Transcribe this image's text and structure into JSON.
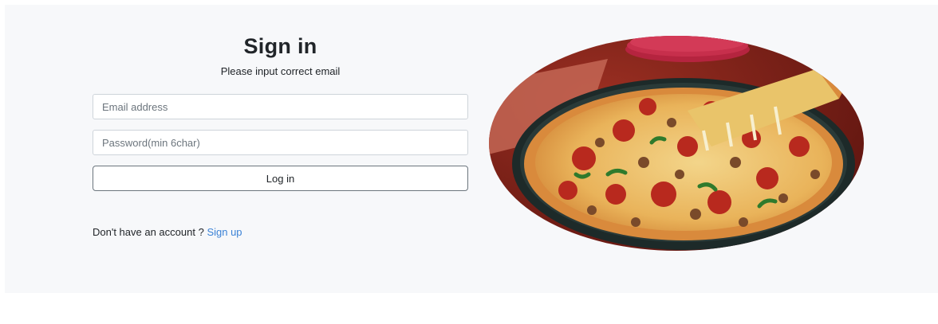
{
  "signin": {
    "title": "Sign in",
    "subtitle": "Please input correct email",
    "email_placeholder": "Email address",
    "password_placeholder": "Password(min 6char)",
    "login_label": "Log in",
    "no_account_text": "Don't have an account ?",
    "signup_link": "Sign up"
  },
  "colors": {
    "link": "#3b82d6",
    "panel_bg": "#f7f8fa",
    "button_border": "#6c757d"
  },
  "image": {
    "subject": "pizza-photo"
  }
}
